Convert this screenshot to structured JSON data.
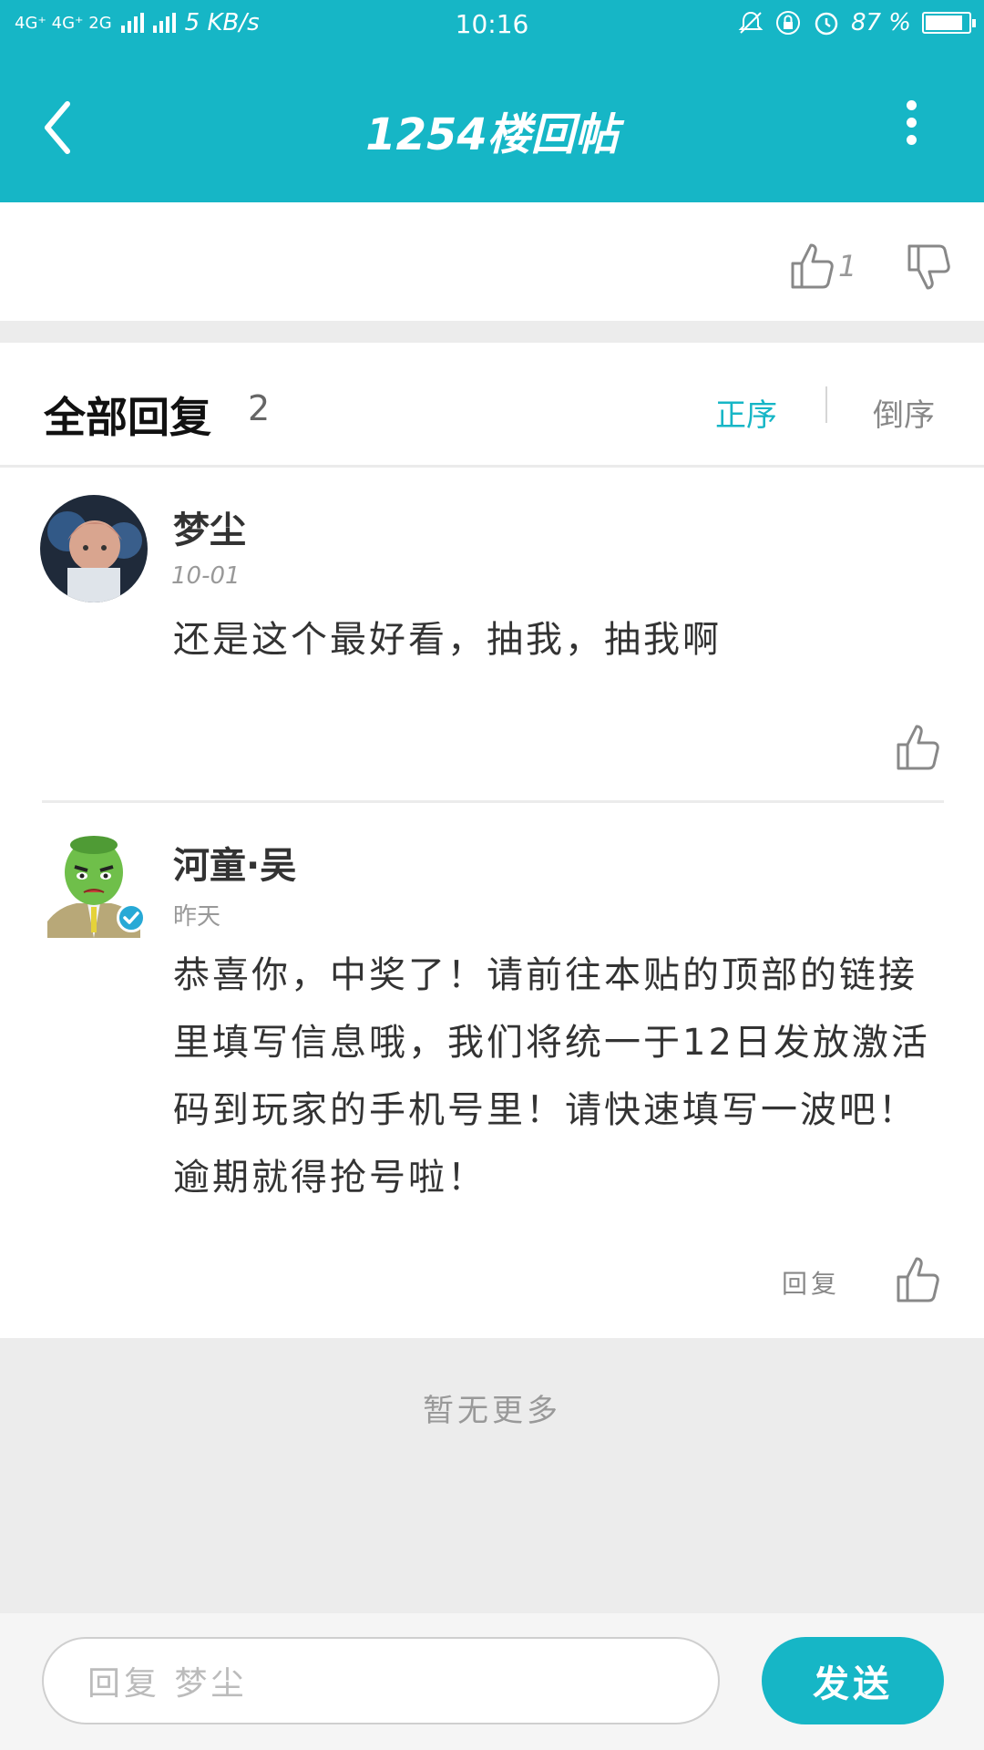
{
  "status_bar": {
    "network": "4G⁺ 4G⁺ 2G",
    "speed": "5  KB/s",
    "time": "10:16",
    "battery": "87 %",
    "battery_level": 0.87
  },
  "app_bar": {
    "title": "1254楼回帖"
  },
  "post_actions": {
    "like_count": "1"
  },
  "replies_header": {
    "title": "全部回复",
    "count": "2",
    "sort_asc": "正序",
    "sort_desc": "倒序",
    "active_sort": "asc"
  },
  "replies": [
    {
      "username": "梦尘",
      "date": "10-01",
      "text": "还是这个最好看，抽我，抽我啊"
    },
    {
      "username": "河童·吴",
      "date": "昨天",
      "text": "恭喜你，中奖了！请前往本贴的顶部的链接里填写信息哦，我们将统一于12日发放激活码到玩家的手机号里！请快速填写一波吧！逾期就得抢号啦！",
      "reply_label": "回复",
      "verified": true
    }
  ],
  "footer": {
    "no_more": "暂无更多"
  },
  "composer": {
    "placeholder": "回复 梦尘",
    "send_label": "发送"
  },
  "colors": {
    "accent": "#16b6c6",
    "background_gray": "#ececec"
  }
}
